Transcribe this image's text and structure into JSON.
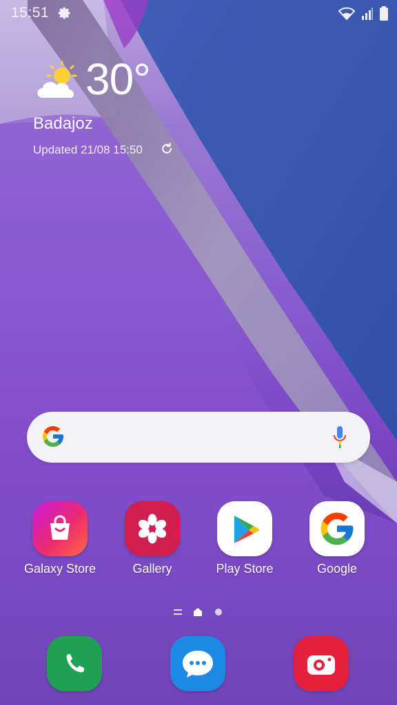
{
  "status_bar": {
    "time": "15:51",
    "icons": [
      "settings-gear-icon",
      "wifi-icon",
      "signal-icon",
      "battery-icon"
    ]
  },
  "weather": {
    "temperature": "30°",
    "city": "Badajoz",
    "updated": "Updated 21/08 15:50",
    "condition_icon": "partly-sunny-icon"
  },
  "search": {
    "logo_icon": "google-g-icon",
    "mic_icon": "mic-icon"
  },
  "apps": [
    {
      "label": "Galaxy Store",
      "icon": "galaxy-store-icon",
      "color": "#e4267a"
    },
    {
      "label": "Gallery",
      "icon": "gallery-flower-icon",
      "color": "#d21d4f"
    },
    {
      "label": "Play Store",
      "icon": "play-store-icon",
      "color": "#ffffff"
    },
    {
      "label": "Google",
      "icon": "google-g-icon",
      "color": "#ffffff"
    }
  ],
  "page_indicator": {
    "pages": [
      "menu",
      "home",
      "page"
    ],
    "active": "home"
  },
  "dock": [
    {
      "icon": "phone-icon",
      "color": "#1fa155"
    },
    {
      "icon": "messages-icon",
      "color": "#1e88e5"
    },
    {
      "icon": "camera-icon",
      "color": "#e5203f"
    }
  ]
}
